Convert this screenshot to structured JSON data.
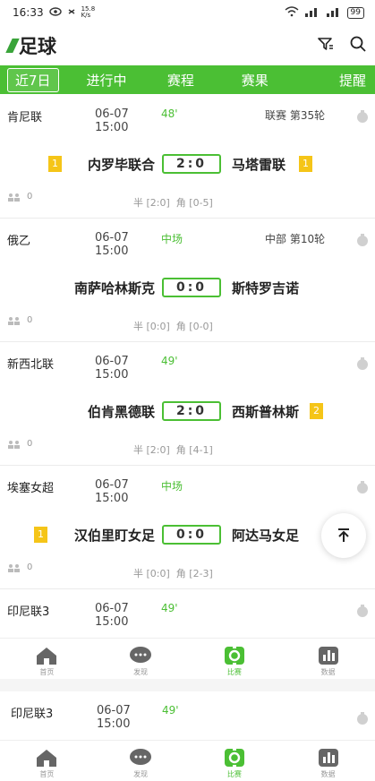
{
  "status": {
    "time": "16:33",
    "speed": "15.8",
    "speed_unit": "K/s",
    "battery": "99"
  },
  "header": {
    "title": "足球"
  },
  "tabs": [
    {
      "label": "近7日",
      "active": true
    },
    {
      "label": "进行中"
    },
    {
      "label": "赛程"
    },
    {
      "label": "赛果"
    },
    {
      "label": "提醒"
    }
  ],
  "matches": [
    {
      "league": "肯尼联",
      "date": "06-07",
      "time": "15:00",
      "state": "48'",
      "round": "联赛 第35轮",
      "home": "内罗毕联合",
      "away": "马塔雷联",
      "score": "2:0",
      "home_card": "1",
      "away_card": "1",
      "fans": "0",
      "half": "半 [2:0]",
      "corner": "角 [0-5]"
    },
    {
      "league": "俄乙",
      "date": "06-07",
      "time": "15:00",
      "state": "中场",
      "round": "中部 第10轮",
      "home": "南萨哈林斯克",
      "away": "斯特罗吉诺",
      "score": "0:0",
      "fans": "0",
      "half": "半 [0:0]",
      "corner": "角 [0-0]"
    },
    {
      "league": "新西北联",
      "date": "06-07",
      "time": "15:00",
      "state": "49'",
      "round": "",
      "home": "伯肯黑德联",
      "away": "西斯普林斯",
      "score": "2:0",
      "away_card": "2",
      "fans": "0",
      "half": "半 [2:0]",
      "corner": "角 [4-1]"
    },
    {
      "league": "埃塞女超",
      "date": "06-07",
      "time": "15:00",
      "state": "中场",
      "round": "",
      "home": "汉伯里盯女足",
      "away": "阿达马女足",
      "score": "0:0",
      "home_card": "1",
      "fans": "0",
      "half": "半 [0:0]",
      "corner": "角 [2-3]"
    },
    {
      "league": "印尼联3",
      "date": "06-07",
      "time": "15:00",
      "state": "49'"
    }
  ],
  "nav": [
    {
      "label": "首页",
      "icon": "home-icon"
    },
    {
      "label": "发现",
      "icon": "chat-icon"
    },
    {
      "label": "比赛",
      "icon": "match-icon",
      "active": true
    },
    {
      "label": "数据",
      "icon": "chart-icon"
    }
  ],
  "second_match": {
    "league": "印尼联3",
    "date": "06-07",
    "time": "15:00",
    "state": "49'"
  },
  "colors": {
    "accent": "#4bbf34",
    "card": "#f5c518"
  }
}
